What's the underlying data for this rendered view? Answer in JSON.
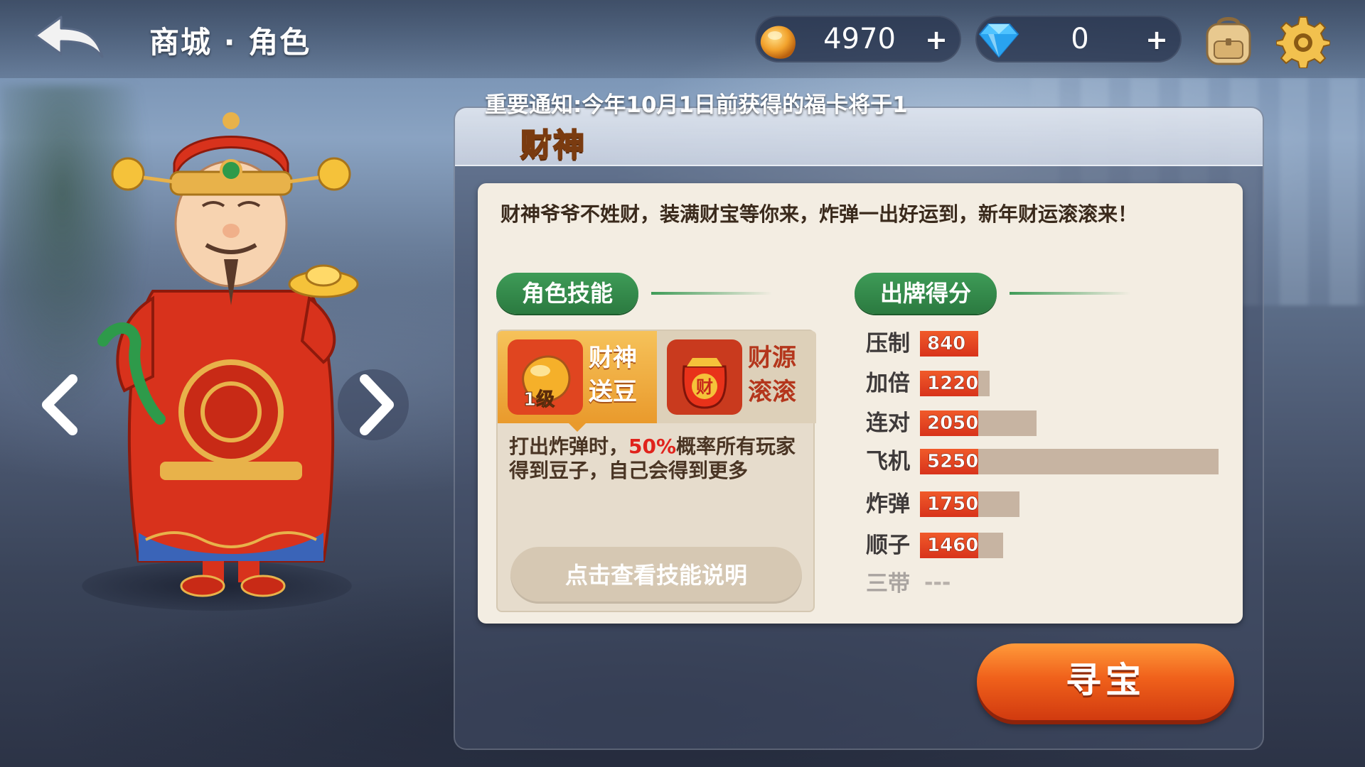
{
  "header": {
    "title": "商城 · 角色",
    "beans": {
      "value": "4970",
      "plus": "+"
    },
    "gems": {
      "value": "0",
      "plus": "+"
    }
  },
  "notice": "重要通知:今年10月1日前获得的福卡将于1",
  "character": {
    "name": "财神",
    "description": "财神爷爷不姓财，装满财宝等你来，炸弹一出好运到，新年财运滚滚来！"
  },
  "skills": {
    "tag": "角色技能",
    "items": [
      {
        "name_line1": "财神",
        "name_line2": "送豆",
        "level": "1级"
      },
      {
        "name_line1": "财源",
        "name_line2": "滚滚",
        "icon_text": "财"
      }
    ],
    "detail_before": "打出炸弹时，",
    "detail_highlight": "50%",
    "detail_after": "概率所有玩家得到豆子，自己会得到更多",
    "detail_button": "点击查看技能说明"
  },
  "scores": {
    "tag": "出牌得分",
    "max": 5250,
    "rows": [
      {
        "label": "压制",
        "value": 840,
        "value_text": "840"
      },
      {
        "label": "加倍",
        "value": 1220,
        "value_text": "1220"
      },
      {
        "label": "连对",
        "value": 2050,
        "value_text": "2050"
      },
      {
        "label": "飞机",
        "value": 5250,
        "value_text": "5250"
      },
      {
        "label": "炸弹",
        "value": 1750,
        "value_text": "1750"
      },
      {
        "label": "顺子",
        "value": 1460,
        "value_text": "1460"
      },
      {
        "label": "三带",
        "value": null,
        "value_text": "---"
      }
    ]
  },
  "treasure_button": "寻宝",
  "colors": {
    "tag_green": "#3e9b57",
    "score_fill": "#f05a2a",
    "score_track": "#c7b4a2",
    "highlight_red": "#e0231c",
    "button_orange": "#f0611b"
  },
  "icons": {
    "back": "back-arrow-icon",
    "beans": "bean-icon",
    "gems": "diamond-icon",
    "backpack": "backpack-icon",
    "settings": "gear-icon",
    "prev": "chevron-left-icon",
    "next": "chevron-right-icon"
  }
}
